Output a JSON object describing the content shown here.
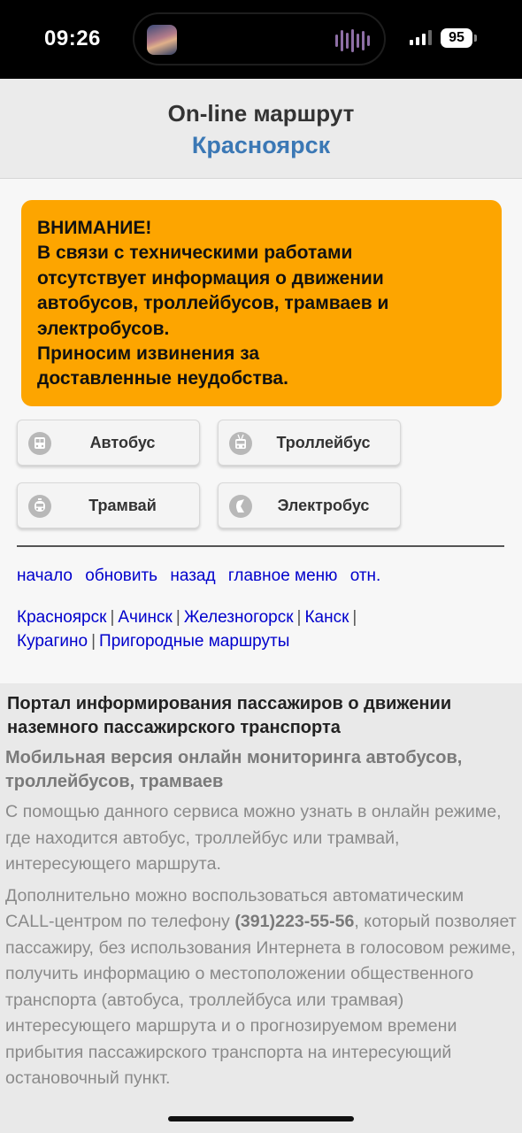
{
  "status_bar": {
    "time": "09:26",
    "battery": "95"
  },
  "header": {
    "title": "On-line маршрут",
    "city": "Красноярск"
  },
  "alert": {
    "lines": [
      "ВНИМАНИЕ!",
      "В связи с техническими работами",
      "отсутствует информация о движении",
      "автобусов, троллейбусов, трамваев и",
      "электробусов.",
      "Приносим извинения за",
      "доставленные неудобства."
    ]
  },
  "transport": {
    "bus": "Автобус",
    "trolleybus": "Троллейбус",
    "tram": "Трамвай",
    "electrobus": "Электробус"
  },
  "nav": {
    "start": "начало",
    "refresh": "обновить",
    "back": "назад",
    "main_menu": "главное меню",
    "rel": "отн."
  },
  "cities": {
    "krasnoyarsk": "Красноярск",
    "achinsk": "Ачинск",
    "zheleznogorsk": "Железногорск",
    "kansk": "Канск",
    "kuragino": "Курагино",
    "suburban": "Пригородные маршруты",
    "separator": "|"
  },
  "info": {
    "heading": "Портал информирования пассажиров о движении наземного пассажирского транспорта",
    "subheading": "Мобильная версия онлайн мониторинга автобусов, троллейбусов, трамваев",
    "paragraph1": "С помощью данного сервиса можно узнать в онлайн режиме, где находится автобус, троллейбус или трамвай, интересующего маршрута.",
    "paragraph2_before": "Дополнительно можно воспользоваться автоматическим CALL-центром по телефону ",
    "phone": "(391)223-55-56",
    "paragraph2_after": ", который позволяет пассажиру, без использования Интернета в голосовом режиме, получить информацию о местоположении общественного транспорта (автобуса, троллейбуса или трамвая) интересующего маршрута и о прогнозируемом времени прибытия пассажирского транспорта на интересующий остановочный пункт."
  },
  "colors": {
    "alert_bg": "#fda500",
    "city_title": "#3b78b5",
    "link": "#0000cc"
  }
}
